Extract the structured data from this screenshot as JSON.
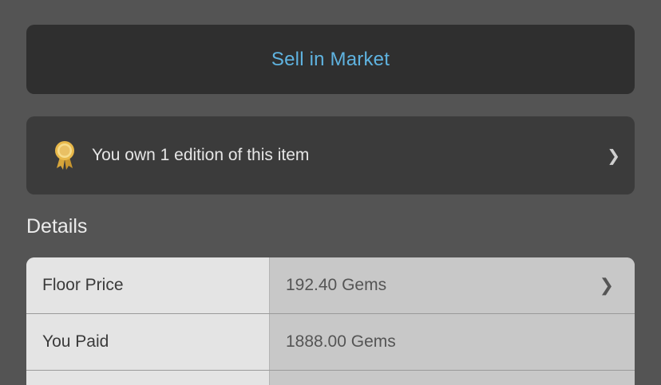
{
  "actions": {
    "sell_label": "Sell in Market"
  },
  "ownership": {
    "icon": "award-ribbon-icon",
    "text": "You own 1 edition of this item",
    "chevron": "❯"
  },
  "details": {
    "heading": "Details",
    "rows": [
      {
        "label": "Floor Price",
        "value": "192.40 Gems",
        "chevron": "❯"
      },
      {
        "label": "You Paid",
        "value": "1888.00 Gems"
      }
    ]
  },
  "colors": {
    "background": "#545454",
    "sell_button_bg": "#2f2f2f",
    "sell_label": "#5fb3e0",
    "ownership_bg": "#3b3b3b",
    "award_gold": "#e8b84a"
  }
}
